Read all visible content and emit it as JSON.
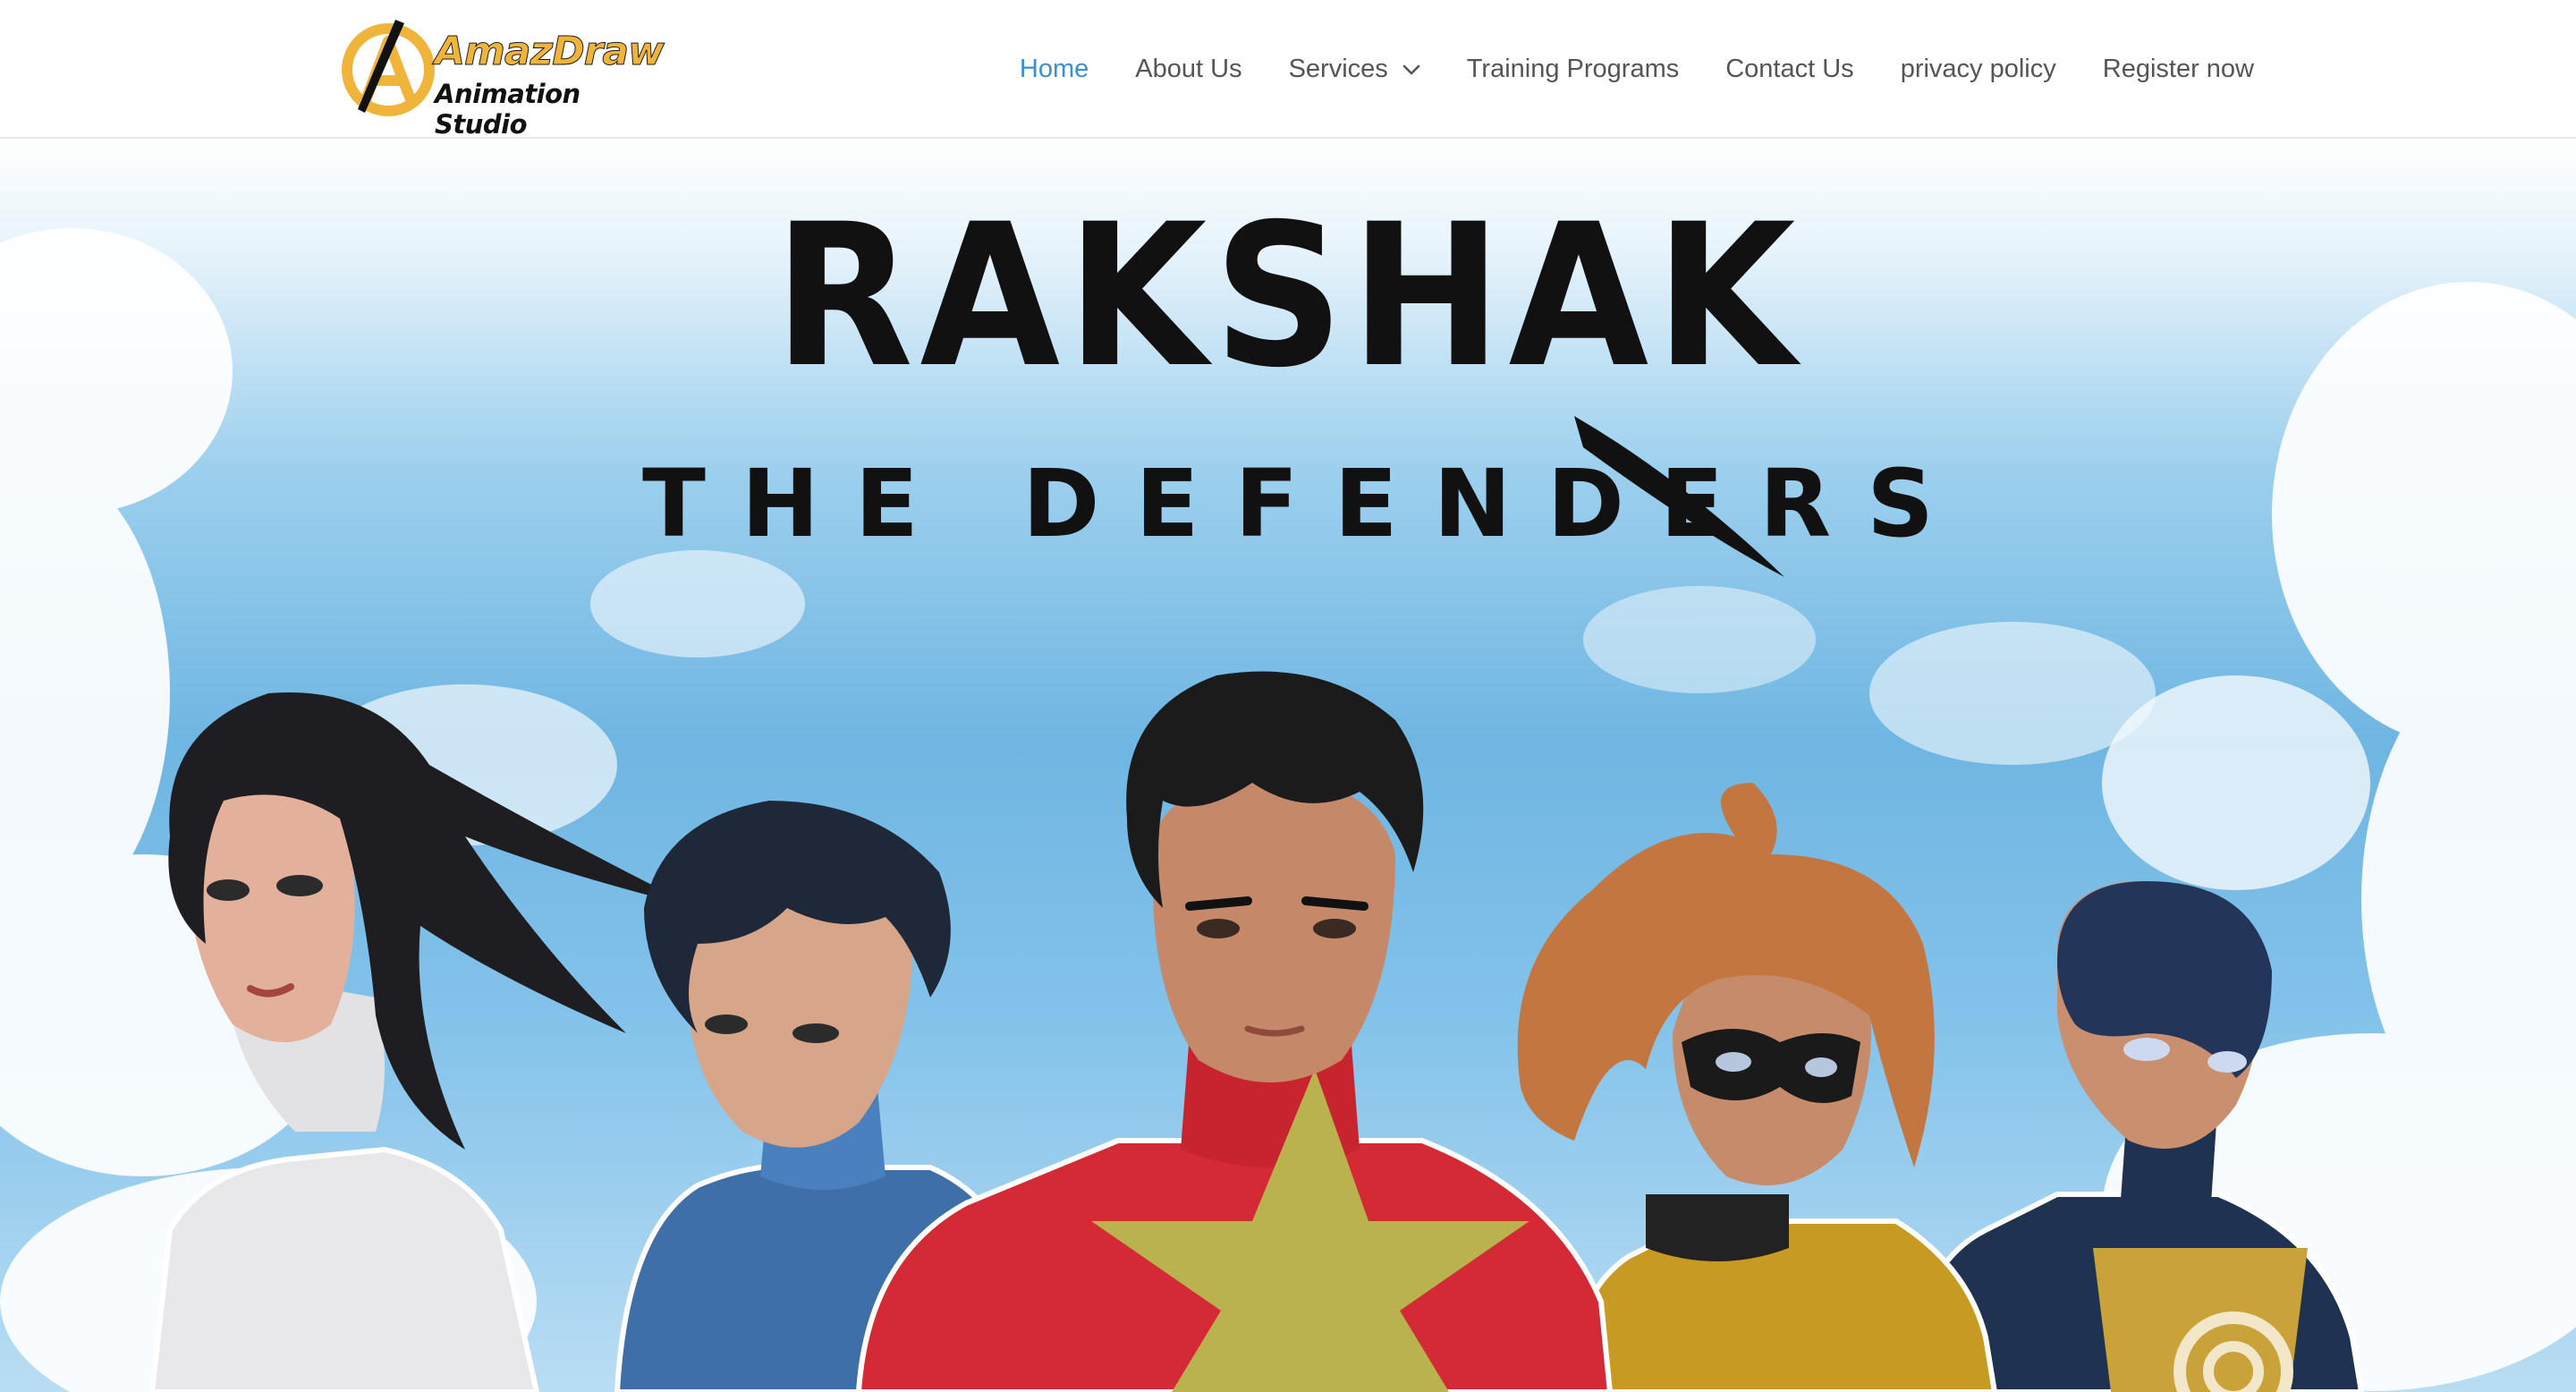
{
  "brand": {
    "name_top": "AmazDraw",
    "name_bottom": "Animation Studio",
    "mark_letter": "A",
    "accent_color": "#f0b43a"
  },
  "nav": {
    "items": [
      {
        "label": "Home",
        "active": true
      },
      {
        "label": "About Us"
      },
      {
        "label": "Services",
        "has_dropdown": true
      },
      {
        "label": "Training Programs"
      },
      {
        "label": "Contact Us"
      },
      {
        "label": "privacy policy"
      },
      {
        "label": "Register now"
      }
    ],
    "active_color": "#3a8ed2",
    "text_color": "#555555"
  },
  "hero": {
    "title": "RAKSHAK",
    "subtitle": "THE DEFENDERS",
    "characters": [
      "white-suit-heroine",
      "blue-suit-hero",
      "red-star-hero",
      "yellow-masked-heroine",
      "navy-masked-hero"
    ]
  }
}
